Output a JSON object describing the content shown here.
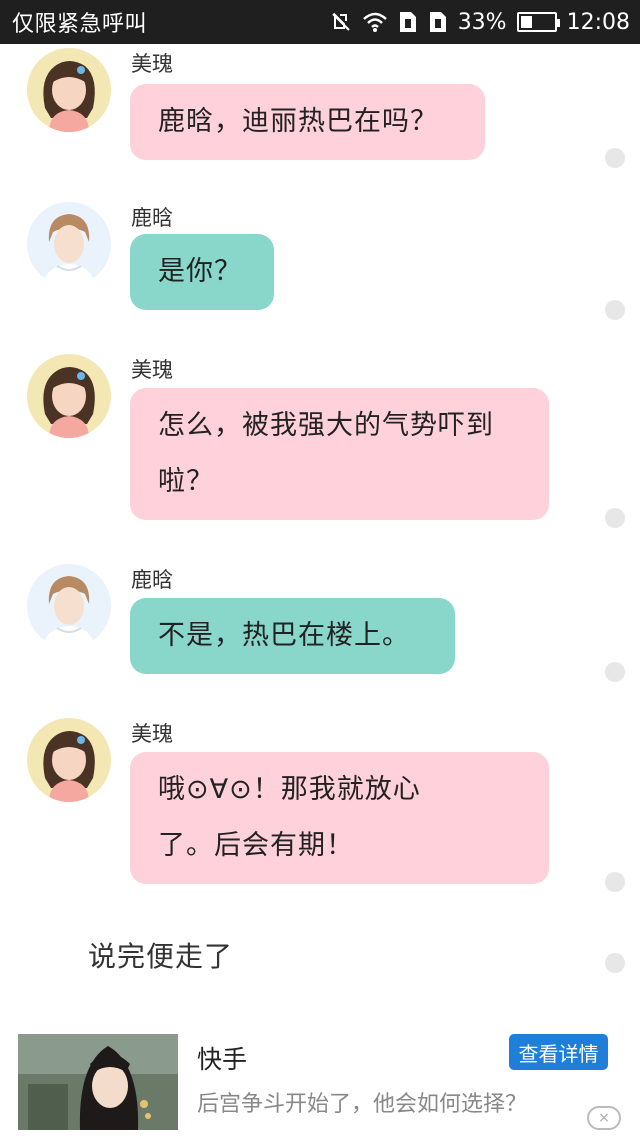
{
  "status_bar": {
    "left_text": "仅限紧急呼叫",
    "battery_percent": "33%",
    "battery_level": 0.33,
    "time": "12:08",
    "icons": [
      "mute-icon",
      "wifi-icon",
      "sim1-icon",
      "sim2-icon",
      "battery-icon"
    ]
  },
  "chat": {
    "colors": {
      "pink_bubble": "#ffd1da",
      "teal_bubble": "#89d7cb",
      "status_bar_bg": "#1f1f1f"
    },
    "messages": [
      {
        "sender": "美瑰",
        "lines": [
          "鹿晗，迪丽热巴在吗？"
        ]
      },
      {
        "sender": "鹿晗",
        "lines": [
          "是你？"
        ]
      },
      {
        "sender": "美瑰",
        "lines": [
          "怎么，被我强大的气势吓到",
          "啦？"
        ]
      },
      {
        "sender": "鹿晗",
        "lines": [
          "不是，热巴在楼上。"
        ]
      },
      {
        "sender": "美瑰",
        "lines": [
          "哦⊙∀⊙！那我就放心",
          "了。后会有期！"
        ]
      }
    ],
    "narration": "说完便走了"
  },
  "ad": {
    "title": "快手",
    "subtitle": "后宫争斗开始了，他会如何选择？",
    "button_label": "查看详情",
    "close_symbol": "×"
  }
}
